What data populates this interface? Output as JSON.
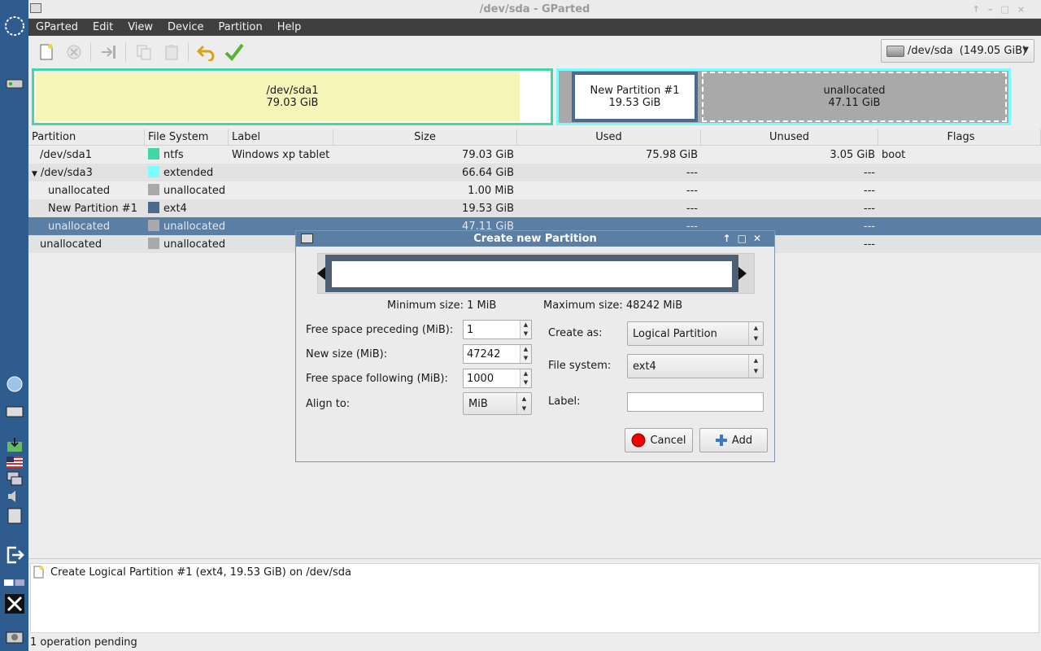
{
  "window": {
    "title": "/dev/sda - GParted"
  },
  "menu": [
    "GParted",
    "Edit",
    "View",
    "Device",
    "Partition",
    "Help"
  ],
  "device_selector": {
    "device": "/dev/sda",
    "size": "(149.05 GiB)"
  },
  "disk_map": {
    "sda1": {
      "name": "/dev/sda1",
      "size": "79.03 GiB"
    },
    "new_partition": {
      "name": "New Partition #1",
      "size": "19.53 GiB"
    },
    "unallocated": {
      "name": "unallocated",
      "size": "47.11 GiB"
    }
  },
  "table": {
    "headers": [
      "Partition",
      "File System",
      "Label",
      "Size",
      "Used",
      "Unused",
      "Flags"
    ],
    "rows": [
      {
        "partition": "/dev/sda1",
        "fs": "ntfs",
        "fs_color": "#42d6a4",
        "label": "Windows xp tablet",
        "size": "79.03 GiB",
        "used": "75.98 GiB",
        "unused": "3.05 GiB",
        "flags": "boot"
      },
      {
        "partition": "/dev/sda3",
        "fs": "extended",
        "fs_color": "#7dfcfe",
        "label": "",
        "size": "66.64 GiB",
        "used": "---",
        "unused": "---",
        "flags": ""
      },
      {
        "partition": "unallocated",
        "fs": "unallocated",
        "fs_color": "#a9a9a9",
        "label": "",
        "size": "1.00 MiB",
        "used": "---",
        "unused": "---",
        "flags": ""
      },
      {
        "partition": "New Partition #1",
        "fs": "ext4",
        "fs_color": "#4b6a8d",
        "label": "",
        "size": "19.53 GiB",
        "used": "---",
        "unused": "---",
        "flags": ""
      },
      {
        "partition": "unallocated",
        "fs": "unallocated",
        "fs_color": "#a9a9a9",
        "label": "",
        "size": "47.11 GiB",
        "used": "---",
        "unused": "---",
        "flags": ""
      },
      {
        "partition": "unallocated",
        "fs": "unallocated",
        "fs_color": "#a9a9a9",
        "label": "",
        "size": "",
        "used": "",
        "unused": "---",
        "flags": ""
      }
    ]
  },
  "dialog": {
    "title": "Create new Partition",
    "min_size": "Minimum size: 1 MiB",
    "max_size": "Maximum size: 48242 MiB",
    "free_preceding_label": "Free space preceding (MiB):",
    "free_preceding_value": "1",
    "new_size_label": "New size (MiB):",
    "new_size_value": "47242",
    "free_following_label": "Free space following (MiB):",
    "free_following_value": "1000",
    "align_label": "Align to:",
    "align_value": "MiB",
    "create_as_label": "Create as:",
    "create_as_value": "Logical Partition",
    "fs_label": "File system:",
    "fs_value": "ext4",
    "label_label": "Label:",
    "label_value": "",
    "cancel": "Cancel",
    "add": "Add"
  },
  "operations": [
    "Create Logical Partition #1 (ext4, 19.53 GiB) on /dev/sda"
  ],
  "status": "1 operation pending",
  "colors": {
    "ntfs": "#42d6a4",
    "extended": "#7dfcfe",
    "ext4": "#4b6a8d",
    "unallocated": "#a9a9a9",
    "selection": "#5b7ea5"
  }
}
